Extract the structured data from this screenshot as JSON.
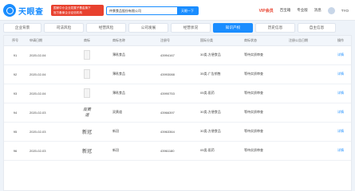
{
  "header": {
    "logo_text": "天眼查",
    "promo_line1": "国家中小企业发展子基金旗下",
    "promo_line2": "官方备案企业征信机构",
    "search_value": "仲景食品股份有限公司",
    "search_button": "天眼一下",
    "vip": "VIP会员",
    "nav": [
      "百宝箱",
      "专业版",
      "消息"
    ],
    "user": "TYO"
  },
  "tabs": [
    {
      "label": "企业背景",
      "count": "",
      "active": false
    },
    {
      "label": "司法风险",
      "count": "",
      "active": false
    },
    {
      "label": "经营风险",
      "count": "",
      "active": false
    },
    {
      "label": "公司发展",
      "count": "",
      "active": false
    },
    {
      "label": "经营状况",
      "count": "",
      "active": false
    },
    {
      "label": "知识产权",
      "count": "",
      "active": true
    },
    {
      "label": "历史信息",
      "count": "",
      "active": false
    },
    {
      "label": "自主信息",
      "count": "",
      "active": false
    }
  ],
  "table": {
    "headers": [
      "序号",
      "申请日期",
      "商标",
      "商标名称",
      "注册号",
      "国际分类",
      "商标状态",
      "注册公告日期",
      "操作"
    ],
    "rows": [
      {
        "index": "91",
        "date": "2020-02-04",
        "mark_type": "plain",
        "name": "薄吼食品",
        "reg_no": "43994167",
        "category": "30类-方便食品",
        "status": "等待实质审查",
        "op": "详情"
      },
      {
        "index": "92",
        "date": "2020-02-04",
        "mark_type": "plain",
        "name": "薄吼食品",
        "reg_no": "43993088",
        "category": "35类-广告销售",
        "status": "等待实质审查",
        "op": "详情"
      },
      {
        "index": "93",
        "date": "2020-02-04",
        "mark_type": "plain",
        "name": "薄吼食品",
        "reg_no": "43990753",
        "category": "05类-医药",
        "status": "等待实质审查",
        "op": "详情"
      },
      {
        "index": "94",
        "date": "2020-02-03",
        "mark_type": "text",
        "mark_text": "双黄道",
        "name": "双黄道",
        "reg_no": "43966397",
        "category": "30类-方便食品",
        "status": "等待实质审查",
        "op": "详情"
      },
      {
        "index": "95",
        "date": "2020-02-03",
        "mark_type": "serif",
        "mark_text": "新冠",
        "name": "新冠",
        "reg_no": "43963364",
        "category": "30类-方便食品",
        "status": "等待实质审查",
        "op": "详情"
      },
      {
        "index": "96",
        "date": "2020-02-03",
        "mark_type": "serif",
        "mark_text": "新冠",
        "name": "新冠",
        "reg_no": "43961180",
        "category": "05类-医药",
        "status": "等待实质审查",
        "op": "详情"
      }
    ]
  }
}
